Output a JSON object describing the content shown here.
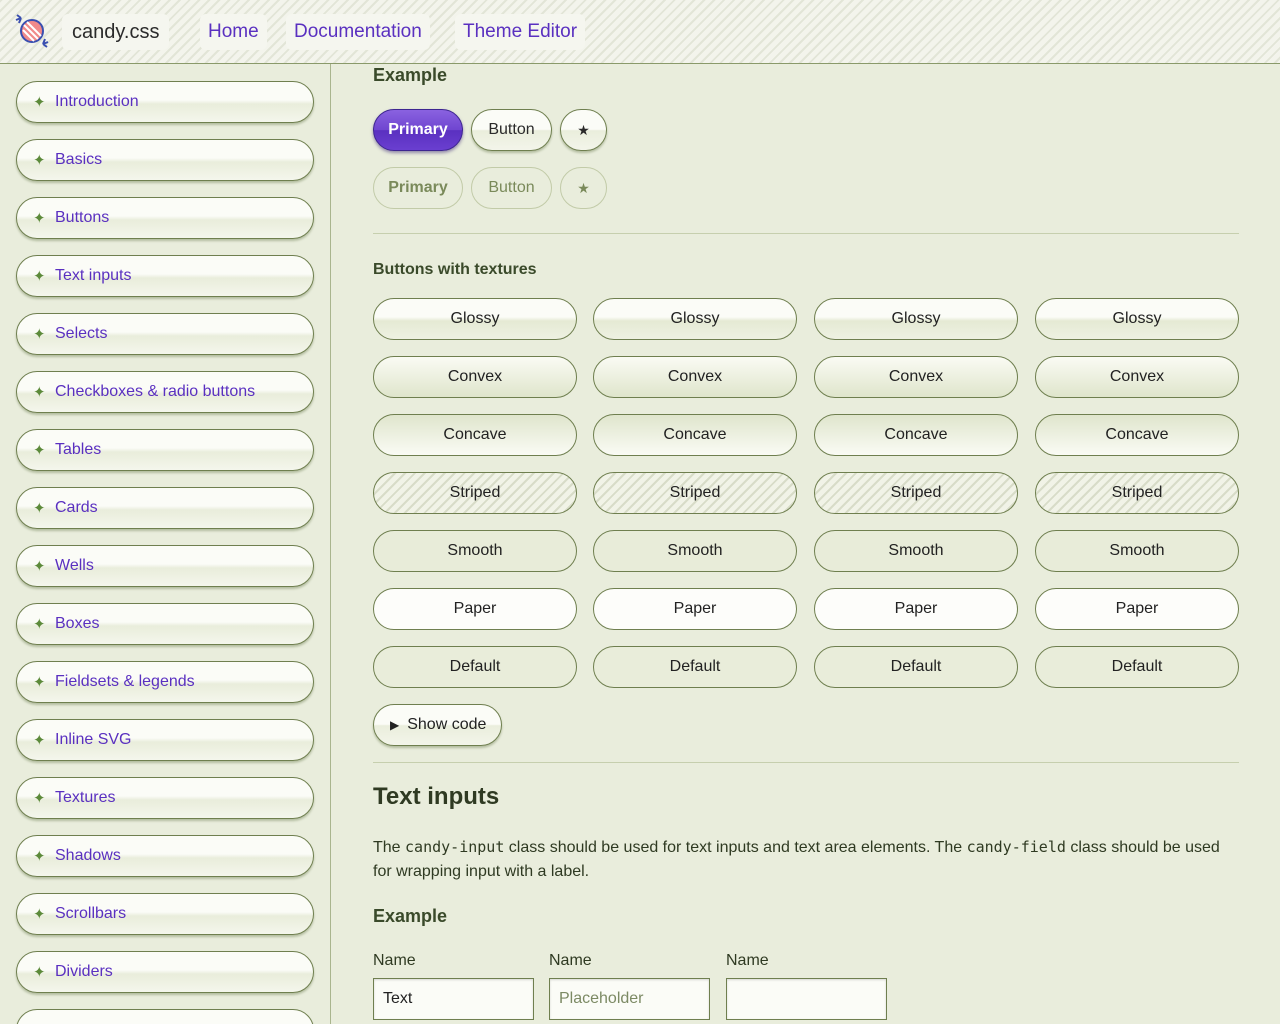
{
  "header": {
    "brand": "candy.css",
    "nav": [
      "Home",
      "Documentation",
      "Theme Editor"
    ]
  },
  "sidebar": {
    "items": [
      "Introduction",
      "Basics",
      "Buttons",
      "Text inputs",
      "Selects",
      "Checkboxes & radio buttons",
      "Tables",
      "Cards",
      "Wells",
      "Boxes",
      "Fieldsets & legends",
      "Inline SVG",
      "Textures",
      "Shadows",
      "Scrollbars",
      "Dividers"
    ]
  },
  "buttons_example": {
    "heading": "Example",
    "primary": "Primary",
    "button": "Button",
    "star": "★",
    "disabled_primary": "Primary",
    "disabled_button": "Button",
    "disabled_star": "★"
  },
  "textures": {
    "heading": "Buttons with textures",
    "rows": [
      "Glossy",
      "Convex",
      "Concave",
      "Striped",
      "Smooth",
      "Paper",
      "Default"
    ],
    "show_code": "Show code"
  },
  "text_inputs": {
    "title": "Text inputs",
    "para_1": "The ",
    "code_1": "candy-input",
    "para_2": " class should be used for text inputs and text area elements. The ",
    "code_2": "candy-field",
    "para_3": " class should be used for wrapping input with a label.",
    "example_heading": "Example",
    "fields": [
      {
        "label": "Name",
        "value": "Text",
        "placeholder": ""
      },
      {
        "label": "Name",
        "value": "",
        "placeholder": "Placeholder"
      },
      {
        "label": "Name",
        "value": "",
        "placeholder": ""
      }
    ]
  },
  "colors": {
    "accent": "#5a30c0",
    "background": "#e9eddc",
    "border": "#6f7f4f",
    "sidebar_star": "#5c8a3a"
  }
}
